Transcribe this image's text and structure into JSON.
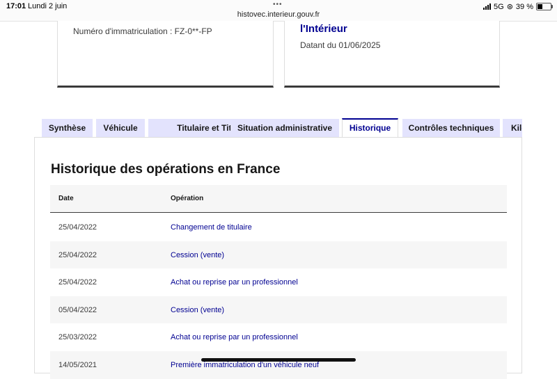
{
  "statusbar": {
    "time": "17:01",
    "date": "Lundi 2 juin",
    "url": "histovec.interieur.gouv.fr",
    "network": "5G",
    "battery": "39 %",
    "battery_level": 0.39
  },
  "cards": {
    "left_text": "Numéro d'immatriculation : FZ-0**-FP",
    "right_title": "l'Intérieur",
    "right_date": "Datant du 01/06/2025"
  },
  "tabs": [
    {
      "label": "Synthèse"
    },
    {
      "label": "Véhicule"
    },
    {
      "label": "Titulaire et Titre"
    },
    {
      "label": "Situation administrative"
    },
    {
      "label": "Historique"
    },
    {
      "label": "Contrôles techniques"
    },
    {
      "label": "Kilométrage"
    }
  ],
  "panel": {
    "title": "Historique des opérations en France",
    "columns": {
      "date": "Date",
      "operation": "Opération"
    },
    "rows": [
      {
        "date": "25/04/2022",
        "operation": "Changement de titulaire"
      },
      {
        "date": "25/04/2022",
        "operation": "Cession (vente)"
      },
      {
        "date": "25/04/2022",
        "operation": "Achat ou reprise par un professionnel"
      },
      {
        "date": "05/04/2022",
        "operation": "Cession (vente)"
      },
      {
        "date": "25/03/2022",
        "operation": "Achat ou reprise par un professionnel"
      },
      {
        "date": "14/05/2021",
        "operation": "Première immatriculation d'un véhicule neuf"
      }
    ]
  },
  "colors": {
    "accent": "#000091",
    "tab_bg": "#e3e3fd"
  }
}
